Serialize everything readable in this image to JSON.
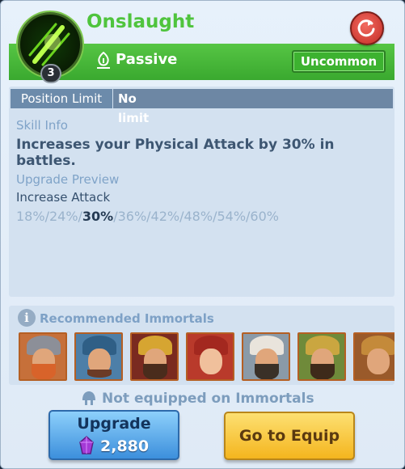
{
  "skill": {
    "name": "Onslaught",
    "level": "3",
    "type": "Passive",
    "rarity": "Uncommon"
  },
  "info": {
    "position_limit_label": "Position Limit",
    "position_limit_value": "No limit",
    "skill_info_title": "Skill Info",
    "description": "Increases your Physical Attack by 30% in battles.",
    "upgrade_preview_title": "Upgrade Preview",
    "upgrade_stat": "Increase Attack",
    "levels_before": "18%/24%/",
    "level_current": "30%",
    "levels_after": "/36%/42%/48%/54%/60%"
  },
  "recommended": {
    "title": "Recommended Immortals",
    "portraits": [
      "immortal-1",
      "immortal-2",
      "immortal-3",
      "immortal-4",
      "immortal-5",
      "immortal-6",
      "immortal-7"
    ]
  },
  "footer": {
    "not_equipped": "Not equipped on Immortals",
    "upgrade_label": "Upgrade",
    "upgrade_cost": "2,880",
    "equip_label": "Go to Equip"
  },
  "colors": {
    "accent_green": "#4fc43d",
    "rarity_green": "#3db230",
    "upgrade_blue": "#3c8fdc",
    "equip_gold": "#f4b51e"
  }
}
